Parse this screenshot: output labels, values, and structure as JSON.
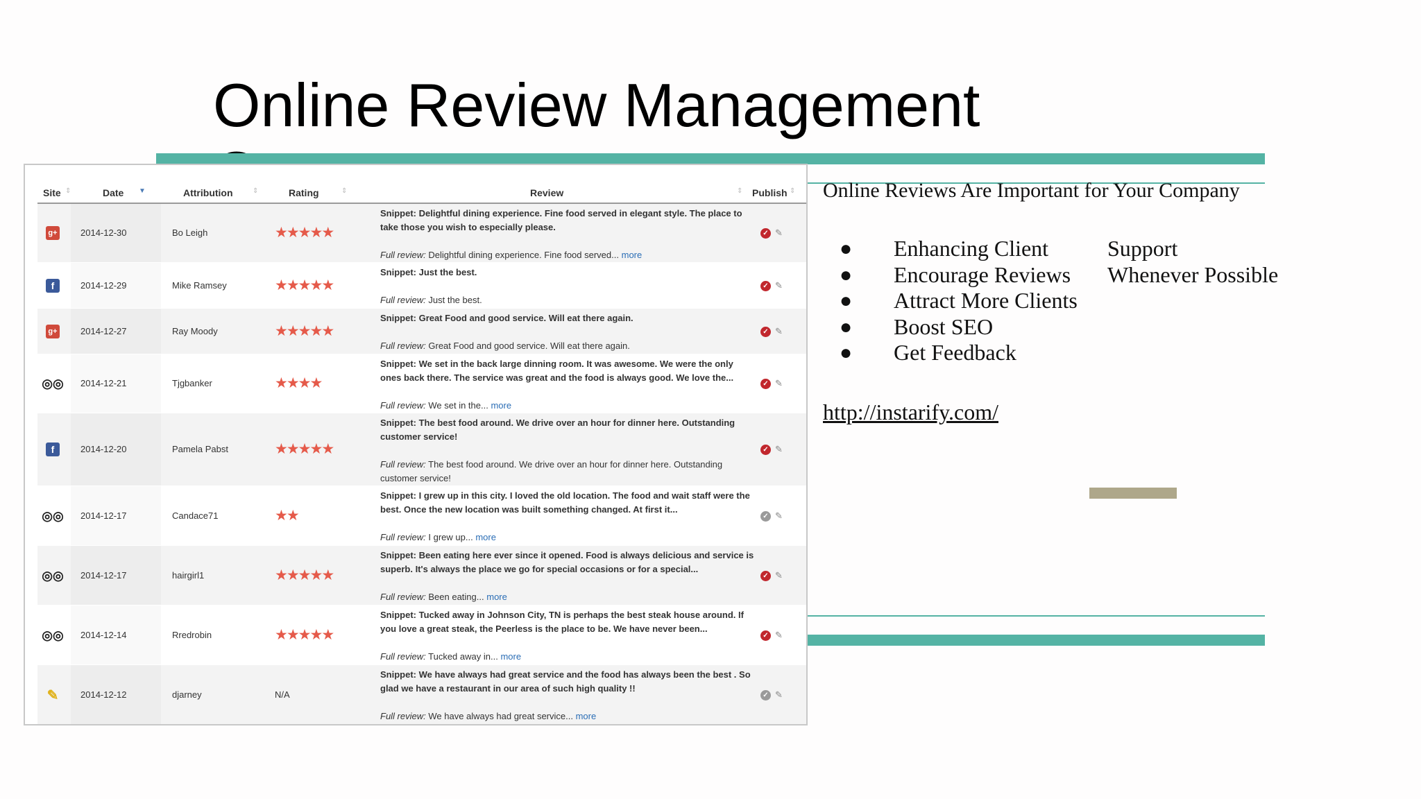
{
  "slide": {
    "title": "Online Review Management",
    "title_line2": "Company",
    "right_heading": "Online Reviews Are Important for Your Company",
    "bullets": [
      {
        "text": "Enhancing Client",
        "text2": "Support"
      },
      {
        "text": "Encourage Reviews",
        "text2": "Whenever Possible"
      },
      {
        "text": "Attract More Clients",
        "text2": ""
      },
      {
        "text": "Boost SEO",
        "text2": ""
      },
      {
        "text": "Get Feedback",
        "text2": ""
      }
    ],
    "link": "http://instarify.com/",
    "accent_color": "#54b3a4",
    "tan_color": "#aea78a"
  },
  "table": {
    "headers": {
      "site": "Site",
      "date": "Date",
      "attribution": "Attribution",
      "rating": "Rating",
      "review": "Review",
      "publish": "Publish"
    },
    "rows": [
      {
        "site": "google-plus-icon",
        "site_glyph": "g+",
        "date": "2014-12-30",
        "attribution": "Bo Leigh",
        "rating": 5,
        "snippet": "Snippet: Delightful dining experience. Fine food served in elegant style. The place to take those you wish to especially please.",
        "full_label": "Full review:",
        "full": "Delightful dining experience. Fine food served...",
        "more": "more",
        "published": true
      },
      {
        "site": "facebook-icon",
        "site_glyph": "f",
        "date": "2014-12-29",
        "attribution": "Mike Ramsey",
        "rating": 5,
        "snippet": "Snippet: Just the best.",
        "full_label": "Full review:",
        "full": "Just the best.",
        "more": "",
        "published": true
      },
      {
        "site": "google-plus-icon",
        "site_glyph": "g+",
        "date": "2014-12-27",
        "attribution": "Ray Moody",
        "rating": 5,
        "snippet": "Snippet: Great Food and good service. Will eat there again.",
        "full_label": "Full review:",
        "full": "Great Food and good service. Will eat there again.",
        "more": "",
        "published": true
      },
      {
        "site": "tripadvisor-icon",
        "site_glyph": "◎◎",
        "date": "2014-12-21",
        "attribution": "Tjgbanker",
        "rating": 4,
        "snippet": "Snippet: We set in the back large dinning room. It was awesome. We were the only ones back there. The service was great and the food is always good. We love the...",
        "full_label": "Full review:",
        "full": "We set in the...",
        "more": "more",
        "published": true
      },
      {
        "site": "facebook-icon",
        "site_glyph": "f",
        "date": "2014-12-20",
        "attribution": "Pamela Pabst",
        "rating": 5,
        "snippet": "Snippet: The best food around. We drive over an hour for dinner here. Outstanding customer service!",
        "full_label": "Full review:",
        "full": "The best food around. We drive over an hour for dinner here. Outstanding customer service!",
        "more": "",
        "published": true
      },
      {
        "site": "tripadvisor-icon",
        "site_glyph": "◎◎",
        "date": "2014-12-17",
        "attribution": "Candace71",
        "rating": 2,
        "snippet": "Snippet: I grew up in this city. I loved the old location. The food and wait staff were the best. Once the new location was built something changed. At first it...",
        "full_label": "Full review:",
        "full": "I grew up...",
        "more": "more",
        "published": false
      },
      {
        "site": "tripadvisor-icon",
        "site_glyph": "◎◎",
        "date": "2014-12-17",
        "attribution": "hairgirl1",
        "rating": 5,
        "snippet": "Snippet: Been eating here ever since it opened. Food is always delicious and service is superb. It's always the place we go for special occasions or for a special...",
        "full_label": "Full review:",
        "full": "Been eating...",
        "more": "more",
        "published": true
      },
      {
        "site": "tripadvisor-icon",
        "site_glyph": "◎◎",
        "date": "2014-12-14",
        "attribution": "Rredrobin",
        "rating": 5,
        "snippet": "Snippet: Tucked away in Johnson City, TN is perhaps the best steak house around. If you love a great steak, the Peerless is the place to be. We have never been...",
        "full_label": "Full review:",
        "full": "Tucked away in...",
        "more": "more",
        "published": true
      },
      {
        "site": "pin-icon",
        "site_glyph": "✎",
        "date": "2014-12-12",
        "attribution": "djarney",
        "rating": "N/A",
        "snippet": "Snippet: We have always had great service and the food has always been the best . So glad we have a restaurant in our area of such high quality !!",
        "full_label": "Full review:",
        "full": "We have always had great service...",
        "more": "more",
        "published": false
      }
    ]
  }
}
